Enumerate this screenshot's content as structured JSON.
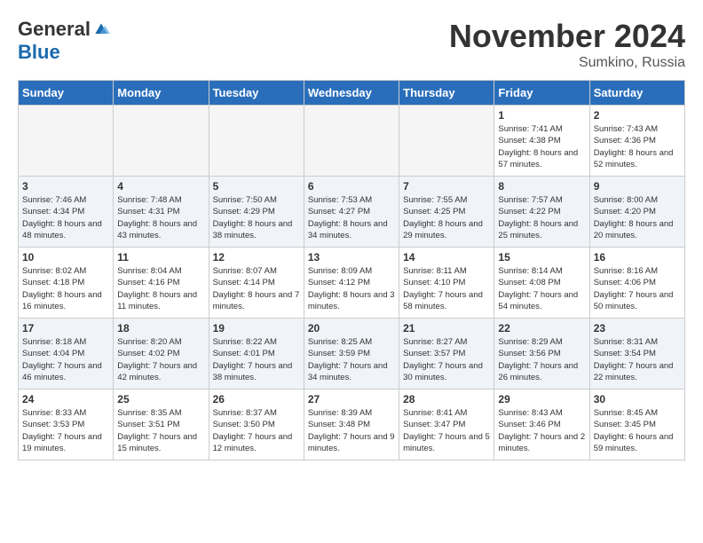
{
  "logo": {
    "general": "General",
    "blue": "Blue"
  },
  "title": "November 2024",
  "subtitle": "Sumkino, Russia",
  "days_of_week": [
    "Sunday",
    "Monday",
    "Tuesday",
    "Wednesday",
    "Thursday",
    "Friday",
    "Saturday"
  ],
  "weeks": [
    [
      {
        "day": "",
        "info": ""
      },
      {
        "day": "",
        "info": ""
      },
      {
        "day": "",
        "info": ""
      },
      {
        "day": "",
        "info": ""
      },
      {
        "day": "",
        "info": ""
      },
      {
        "day": "1",
        "info": "Sunrise: 7:41 AM\nSunset: 4:38 PM\nDaylight: 8 hours and 57 minutes."
      },
      {
        "day": "2",
        "info": "Sunrise: 7:43 AM\nSunset: 4:36 PM\nDaylight: 8 hours and 52 minutes."
      }
    ],
    [
      {
        "day": "3",
        "info": "Sunrise: 7:46 AM\nSunset: 4:34 PM\nDaylight: 8 hours and 48 minutes."
      },
      {
        "day": "4",
        "info": "Sunrise: 7:48 AM\nSunset: 4:31 PM\nDaylight: 8 hours and 43 minutes."
      },
      {
        "day": "5",
        "info": "Sunrise: 7:50 AM\nSunset: 4:29 PM\nDaylight: 8 hours and 38 minutes."
      },
      {
        "day": "6",
        "info": "Sunrise: 7:53 AM\nSunset: 4:27 PM\nDaylight: 8 hours and 34 minutes."
      },
      {
        "day": "7",
        "info": "Sunrise: 7:55 AM\nSunset: 4:25 PM\nDaylight: 8 hours and 29 minutes."
      },
      {
        "day": "8",
        "info": "Sunrise: 7:57 AM\nSunset: 4:22 PM\nDaylight: 8 hours and 25 minutes."
      },
      {
        "day": "9",
        "info": "Sunrise: 8:00 AM\nSunset: 4:20 PM\nDaylight: 8 hours and 20 minutes."
      }
    ],
    [
      {
        "day": "10",
        "info": "Sunrise: 8:02 AM\nSunset: 4:18 PM\nDaylight: 8 hours and 16 minutes."
      },
      {
        "day": "11",
        "info": "Sunrise: 8:04 AM\nSunset: 4:16 PM\nDaylight: 8 hours and 11 minutes."
      },
      {
        "day": "12",
        "info": "Sunrise: 8:07 AM\nSunset: 4:14 PM\nDaylight: 8 hours and 7 minutes."
      },
      {
        "day": "13",
        "info": "Sunrise: 8:09 AM\nSunset: 4:12 PM\nDaylight: 8 hours and 3 minutes."
      },
      {
        "day": "14",
        "info": "Sunrise: 8:11 AM\nSunset: 4:10 PM\nDaylight: 7 hours and 58 minutes."
      },
      {
        "day": "15",
        "info": "Sunrise: 8:14 AM\nSunset: 4:08 PM\nDaylight: 7 hours and 54 minutes."
      },
      {
        "day": "16",
        "info": "Sunrise: 8:16 AM\nSunset: 4:06 PM\nDaylight: 7 hours and 50 minutes."
      }
    ],
    [
      {
        "day": "17",
        "info": "Sunrise: 8:18 AM\nSunset: 4:04 PM\nDaylight: 7 hours and 46 minutes."
      },
      {
        "day": "18",
        "info": "Sunrise: 8:20 AM\nSunset: 4:02 PM\nDaylight: 7 hours and 42 minutes."
      },
      {
        "day": "19",
        "info": "Sunrise: 8:22 AM\nSunset: 4:01 PM\nDaylight: 7 hours and 38 minutes."
      },
      {
        "day": "20",
        "info": "Sunrise: 8:25 AM\nSunset: 3:59 PM\nDaylight: 7 hours and 34 minutes."
      },
      {
        "day": "21",
        "info": "Sunrise: 8:27 AM\nSunset: 3:57 PM\nDaylight: 7 hours and 30 minutes."
      },
      {
        "day": "22",
        "info": "Sunrise: 8:29 AM\nSunset: 3:56 PM\nDaylight: 7 hours and 26 minutes."
      },
      {
        "day": "23",
        "info": "Sunrise: 8:31 AM\nSunset: 3:54 PM\nDaylight: 7 hours and 22 minutes."
      }
    ],
    [
      {
        "day": "24",
        "info": "Sunrise: 8:33 AM\nSunset: 3:53 PM\nDaylight: 7 hours and 19 minutes."
      },
      {
        "day": "25",
        "info": "Sunrise: 8:35 AM\nSunset: 3:51 PM\nDaylight: 7 hours and 15 minutes."
      },
      {
        "day": "26",
        "info": "Sunrise: 8:37 AM\nSunset: 3:50 PM\nDaylight: 7 hours and 12 minutes."
      },
      {
        "day": "27",
        "info": "Sunrise: 8:39 AM\nSunset: 3:48 PM\nDaylight: 7 hours and 9 minutes."
      },
      {
        "day": "28",
        "info": "Sunrise: 8:41 AM\nSunset: 3:47 PM\nDaylight: 7 hours and 5 minutes."
      },
      {
        "day": "29",
        "info": "Sunrise: 8:43 AM\nSunset: 3:46 PM\nDaylight: 7 hours and 2 minutes."
      },
      {
        "day": "30",
        "info": "Sunrise: 8:45 AM\nSunset: 3:45 PM\nDaylight: 6 hours and 59 minutes."
      }
    ]
  ]
}
